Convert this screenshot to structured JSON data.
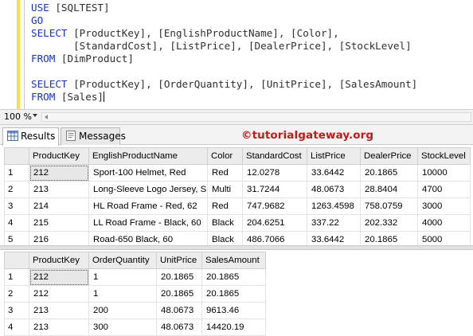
{
  "editor": {
    "lines": [
      {
        "kw": "USE",
        "rest": " [SQLTEST]"
      },
      {
        "kw": "GO",
        "rest": ""
      },
      {
        "kw": "SELECT",
        "rest": " [ProductKey], [EnglishProductName], [Color],"
      },
      {
        "kw": "",
        "rest": "       [StandardCost], [ListPrice], [DealerPrice], [StockLevel]"
      },
      {
        "kw": "FROM",
        "rest": " [DimProduct]"
      },
      {
        "kw": "",
        "rest": ""
      },
      {
        "kw": "SELECT",
        "rest": " [ProductKey], [OrderQuantity], [UnitPrice], [SalesAmount]"
      },
      {
        "kw": "FROM",
        "rest": " [Sales]"
      }
    ]
  },
  "zoom": {
    "value": "100 %"
  },
  "tabs": {
    "results": "Results",
    "messages": "Messages"
  },
  "watermark": "©tutorialgateway.org",
  "grid1": {
    "headers": [
      "ProductKey",
      "EnglishProductName",
      "Color",
      "StandardCost",
      "ListPrice",
      "DealerPrice",
      "StockLevel"
    ],
    "rows": [
      {
        "n": "1",
        "cells": [
          "212",
          "Sport-100 Helmet, Red",
          "Red",
          "12.0278",
          "33.6442",
          "20.1865",
          "10000"
        ]
      },
      {
        "n": "2",
        "cells": [
          "213",
          "Long-Sleeve Logo Jersey, S",
          "Multi",
          "31.7244",
          "48.0673",
          "28.8404",
          "4700"
        ]
      },
      {
        "n": "3",
        "cells": [
          "214",
          "HL Road Frame - Red, 62",
          "Red",
          "747.9682",
          "1263.4598",
          "758.0759",
          "3000"
        ]
      },
      {
        "n": "4",
        "cells": [
          "215",
          "LL Road Frame - Black, 60",
          "Black",
          "204.6251",
          "337.22",
          "202.332",
          "4000"
        ]
      },
      {
        "n": "5",
        "cells": [
          "216",
          "Road-650 Black, 60",
          "Black",
          "486.7066",
          "33.6442",
          "20.1865",
          "5000"
        ]
      }
    ]
  },
  "grid2": {
    "headers": [
      "ProductKey",
      "OrderQuantity",
      "UnitPrice",
      "SalesAmount"
    ],
    "rows": [
      {
        "n": "1",
        "cells": [
          "212",
          "1",
          "20.1865",
          "20.1865"
        ]
      },
      {
        "n": "2",
        "cells": [
          "212",
          "1",
          "20.1865",
          "20.1865"
        ]
      },
      {
        "n": "3",
        "cells": [
          "213",
          "200",
          "48.0673",
          "9613.46"
        ]
      },
      {
        "n": "4",
        "cells": [
          "213",
          "300",
          "48.0673",
          "14420.19"
        ]
      }
    ]
  },
  "colors": {
    "keyword": "#1a32c8",
    "watermark": "#c21b1b",
    "change_bar": "#f4e04a"
  },
  "icons": {
    "results_tab": "grid-icon",
    "messages_tab": "messages-icon",
    "zoom_dropdown": "chevron-down-icon"
  }
}
